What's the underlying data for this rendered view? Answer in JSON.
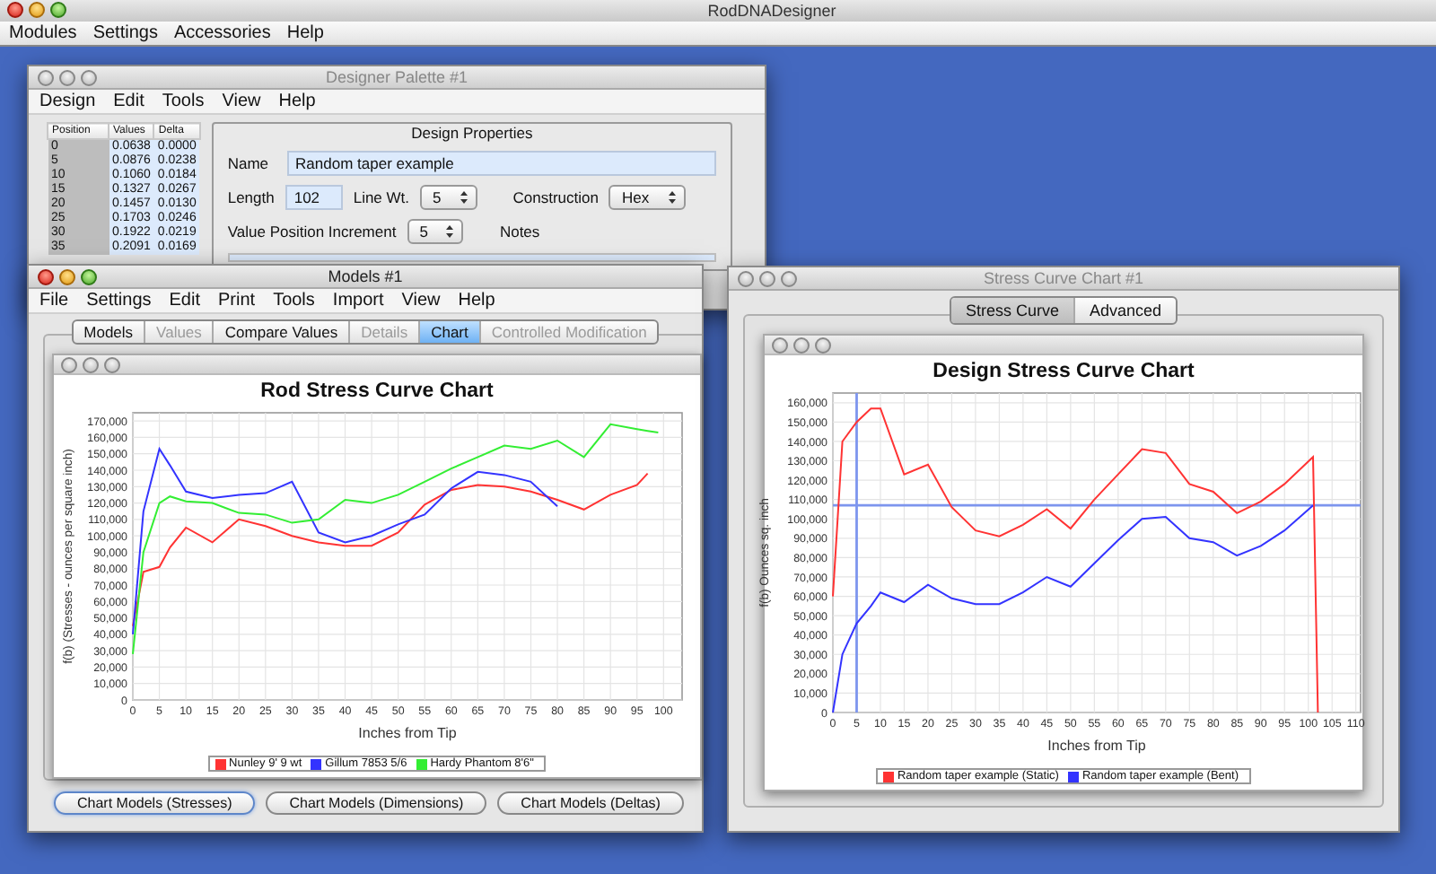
{
  "app": {
    "title": "RodDNADesigner",
    "menu": [
      "Modules",
      "Settings",
      "Accessories",
      "Help"
    ]
  },
  "designer_palette": {
    "title": "Designer Palette #1",
    "menu": [
      "Design",
      "Edit",
      "Tools",
      "View",
      "Help"
    ],
    "table": {
      "columns": [
        "Position",
        "Values",
        "Delta"
      ],
      "rows": [
        [
          "0",
          "0.0638",
          "0.0000"
        ],
        [
          "5",
          "0.0876",
          "0.0238"
        ],
        [
          "10",
          "0.1060",
          "0.0184"
        ],
        [
          "15",
          "0.1327",
          "0.0267"
        ],
        [
          "20",
          "0.1457",
          "0.0130"
        ],
        [
          "25",
          "0.1703",
          "0.0246"
        ],
        [
          "30",
          "0.1922",
          "0.0219"
        ],
        [
          "35",
          "0.2091",
          "0.0169"
        ]
      ]
    },
    "properties": {
      "heading": "Design Properties",
      "name_label": "Name",
      "name_value": "Random taper example",
      "length_label": "Length",
      "length_value": "102",
      "line_wt_label": "Line Wt.",
      "line_wt_value": "5",
      "construction_label": "Construction",
      "construction_value": "Hex",
      "increment_label": "Value Position Increment",
      "increment_value": "5",
      "notes_label": "Notes"
    }
  },
  "models_window": {
    "title": "Models #1",
    "menu": [
      "File",
      "Settings",
      "Edit",
      "Print",
      "Tools",
      "Import",
      "View",
      "Help"
    ],
    "tabs": [
      {
        "label": "Models",
        "selected": false,
        "disabled": false
      },
      {
        "label": "Values",
        "selected": false,
        "disabled": true
      },
      {
        "label": "Compare Values",
        "selected": false,
        "disabled": false
      },
      {
        "label": "Details",
        "selected": false,
        "disabled": true
      },
      {
        "label": "Chart",
        "selected": true,
        "disabled": false
      },
      {
        "label": "Controlled Modification",
        "selected": false,
        "disabled": true
      }
    ],
    "chart_data": {
      "type": "line",
      "title": "Rod Stress Curve Chart",
      "xlabel": "Inches from Tip",
      "ylabel": "f(b) (Stresses - ounces per square inch)",
      "x": [
        0,
        2,
        5,
        7,
        10,
        15,
        20,
        25,
        30,
        35,
        40,
        45,
        50,
        55,
        60,
        65,
        70,
        75,
        80,
        85,
        90,
        95,
        97,
        99
      ],
      "series": [
        {
          "name": "Nunley 9' 9 wt",
          "color": "#ff3333",
          "values": [
            45000,
            78000,
            81000,
            93000,
            105000,
            96000,
            110000,
            106000,
            100000,
            96000,
            94000,
            94000,
            102000,
            119000,
            128000,
            131000,
            130000,
            127000,
            122000,
            116000,
            125000,
            131000,
            138000,
            null
          ]
        },
        {
          "name": "Gillum 7853 5/6",
          "color": "#3333ff",
          "values": [
            40000,
            115000,
            153000,
            143000,
            127000,
            123000,
            125000,
            126000,
            133000,
            102000,
            96000,
            100000,
            107000,
            113000,
            129000,
            139000,
            137000,
            133000,
            118000,
            null,
            null,
            null,
            null,
            null
          ]
        },
        {
          "name": "Hardy Phantom 8'6\"",
          "color": "#33ee33",
          "values": [
            28000,
            90000,
            120000,
            124000,
            121000,
            120000,
            114000,
            113000,
            108000,
            110000,
            122000,
            120000,
            125000,
            133000,
            141000,
            148000,
            155000,
            153000,
            158000,
            148000,
            168000,
            165000,
            164000,
            163000
          ]
        }
      ],
      "xlim": [
        0,
        103.5
      ],
      "ylim": [
        0,
        175000
      ],
      "xticks": [
        0,
        5,
        10,
        15,
        20,
        25,
        30,
        35,
        40,
        45,
        50,
        55,
        60,
        65,
        70,
        75,
        80,
        85,
        90,
        95,
        100
      ],
      "grid": true,
      "yticks": [
        {
          "value": 0,
          "label": "0"
        },
        {
          "value": 10000,
          "label": "10,000"
        },
        {
          "value": 20000,
          "label": "20,000"
        },
        {
          "value": 30000,
          "label": "30,000"
        },
        {
          "value": 40000,
          "label": "40,000"
        },
        {
          "value": 50000,
          "label": "50,000"
        },
        {
          "value": 60000,
          "label": "60,000"
        },
        {
          "value": 70000,
          "label": "70,000"
        },
        {
          "value": 80000,
          "label": "80,000"
        },
        {
          "value": 90000,
          "label": "90,000"
        },
        {
          "value": 100000,
          "label": "100,000"
        },
        {
          "value": 110000,
          "label": "110,000"
        },
        {
          "value": 120000,
          "label": "120,000"
        },
        {
          "value": 130000,
          "label": "130,000"
        },
        {
          "value": 140000,
          "label": "140,000"
        },
        {
          "value": 150000,
          "label": "150,000"
        },
        {
          "value": 160000,
          "label": "160,000"
        },
        {
          "value": 170000,
          "label": "170,000"
        }
      ]
    },
    "buttons": [
      {
        "label": "Chart Models (Stresses)",
        "default": true
      },
      {
        "label": "Chart Models (Dimensions)",
        "default": false
      },
      {
        "label": "Chart Models (Deltas)",
        "default": false
      }
    ]
  },
  "stress_window": {
    "title": "Stress Curve Chart #1",
    "tabs": [
      {
        "label": "Stress Curve",
        "selected": true
      },
      {
        "label": "Advanced",
        "selected": false
      }
    ],
    "chart_data": {
      "type": "line",
      "title": "Design Stress Curve Chart",
      "xlabel": "Inches from Tip",
      "ylabel": "f(b) Ounces sq. inch",
      "x": [
        0,
        2,
        5,
        8,
        10,
        15,
        20,
        25,
        30,
        35,
        40,
        45,
        50,
        55,
        60,
        65,
        70,
        75,
        80,
        85,
        90,
        95,
        101,
        102
      ],
      "series": [
        {
          "name": "Random taper example (Static)",
          "color": "#ff3333",
          "values": [
            60000,
            140000,
            150000,
            157000,
            157000,
            123000,
            128000,
            106000,
            94000,
            91000,
            97000,
            105000,
            95000,
            110000,
            123000,
            136000,
            134000,
            118000,
            114000,
            103000,
            109000,
            118000,
            132000,
            0
          ]
        },
        {
          "name": "Random taper example (Bent)",
          "color": "#3333ff",
          "values": [
            0,
            30000,
            46000,
            55000,
            62000,
            57000,
            66000,
            59000,
            56000,
            56000,
            62000,
            70000,
            65000,
            77000,
            89000,
            100000,
            101000,
            90000,
            88000,
            81000,
            86000,
            94000,
            107000,
            null
          ]
        }
      ],
      "xlim": [
        0,
        111
      ],
      "ylim": [
        0,
        165000
      ],
      "xticks": [
        0,
        5,
        10,
        15,
        20,
        25,
        30,
        35,
        40,
        45,
        50,
        55,
        60,
        65,
        70,
        75,
        80,
        85,
        90,
        95,
        100,
        105,
        110
      ],
      "grid": true,
      "yticks": [
        {
          "value": 0,
          "label": "0"
        },
        {
          "value": 10000,
          "label": "10,000"
        },
        {
          "value": 20000,
          "label": "20,000"
        },
        {
          "value": 30000,
          "label": "30,000"
        },
        {
          "value": 40000,
          "label": "40,000"
        },
        {
          "value": 50000,
          "label": "50,000"
        },
        {
          "value": 60000,
          "label": "60,000"
        },
        {
          "value": 70000,
          "label": "70,000"
        },
        {
          "value": 80000,
          "label": "80,000"
        },
        {
          "value": 90000,
          "label": "90,000"
        },
        {
          "value": 100000,
          "label": "100,000"
        },
        {
          "value": 110000,
          "label": "110,000"
        },
        {
          "value": 120000,
          "label": "120,000"
        },
        {
          "value": 130000,
          "label": "130,000"
        },
        {
          "value": 140000,
          "label": "140,000"
        },
        {
          "value": 150000,
          "label": "150,000"
        },
        {
          "value": 160000,
          "label": "160,000"
        }
      ],
      "ref_lines": [
        {
          "axis": "x",
          "value": 5
        },
        {
          "axis": "y",
          "value": 107000
        }
      ]
    }
  }
}
